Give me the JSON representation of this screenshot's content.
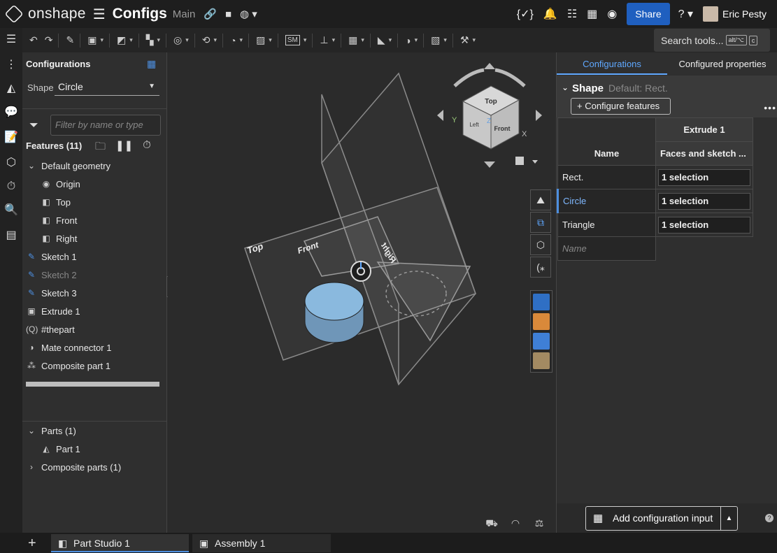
{
  "app": {
    "brand": "onshape",
    "doc_title": "Configs",
    "branch": "Main"
  },
  "topbar": {
    "share_label": "Share",
    "user_name": "Eric Pesty"
  },
  "toolbar": {
    "search_label": "Search tools...",
    "kbd1": "alt/⌥",
    "kbd2": "c",
    "sm_label": "SM"
  },
  "config_panel": {
    "title": "Configurations",
    "shape_label": "Shape",
    "shape_value": "Circle",
    "filter_placeholder": "Filter by name or type",
    "features_header": "Features (11)"
  },
  "tree": {
    "features": [
      {
        "label": "Default geometry",
        "kind": "group"
      },
      {
        "label": "Origin",
        "kind": "child"
      },
      {
        "label": "Top",
        "kind": "child"
      },
      {
        "label": "Front",
        "kind": "child"
      },
      {
        "label": "Right",
        "kind": "child"
      },
      {
        "label": "Sketch 1",
        "kind": "feature"
      },
      {
        "label": "Sketch 2",
        "kind": "feature-dim"
      },
      {
        "label": "Sketch 3",
        "kind": "feature"
      },
      {
        "label": "Extrude 1",
        "kind": "feature"
      },
      {
        "label": "#thepart",
        "kind": "feature"
      },
      {
        "label": "Mate connector 1",
        "kind": "feature"
      },
      {
        "label": "Composite part 1",
        "kind": "feature"
      }
    ],
    "parts_header": "Parts (1)",
    "part_item": "Part 1",
    "composite_header": "Composite parts (1)"
  },
  "viewcube": {
    "top": "Top",
    "front": "Front",
    "left": "Left",
    "x": "X",
    "y": "Y",
    "z": "Z"
  },
  "planes": {
    "top": "Top",
    "front": "Front",
    "right": "Right"
  },
  "right_panel": {
    "tab_configurations": "Configurations",
    "tab_configured_properties": "Configured properties",
    "shape_name": "Shape",
    "shape_default": "Default: Rect.",
    "configure_features": "Configure features",
    "col_feature": "Extrude 1",
    "col_name": "Name",
    "col_faces": "Faces and sketch ...",
    "rows": [
      {
        "name": "Rect.",
        "value": "1 selection"
      },
      {
        "name": "Circle",
        "value": "1 selection"
      },
      {
        "name": "Triangle",
        "value": "1 selection"
      }
    ],
    "new_name_placeholder": "Name",
    "add_config_input": "Add configuration input"
  },
  "tabs": [
    {
      "label": "Part Studio 1"
    },
    {
      "label": "Assembly 1"
    }
  ],
  "colors": {
    "accent": "#4d8fe0",
    "share": "#1f5fbf",
    "part_fill": "#8ab9de"
  }
}
